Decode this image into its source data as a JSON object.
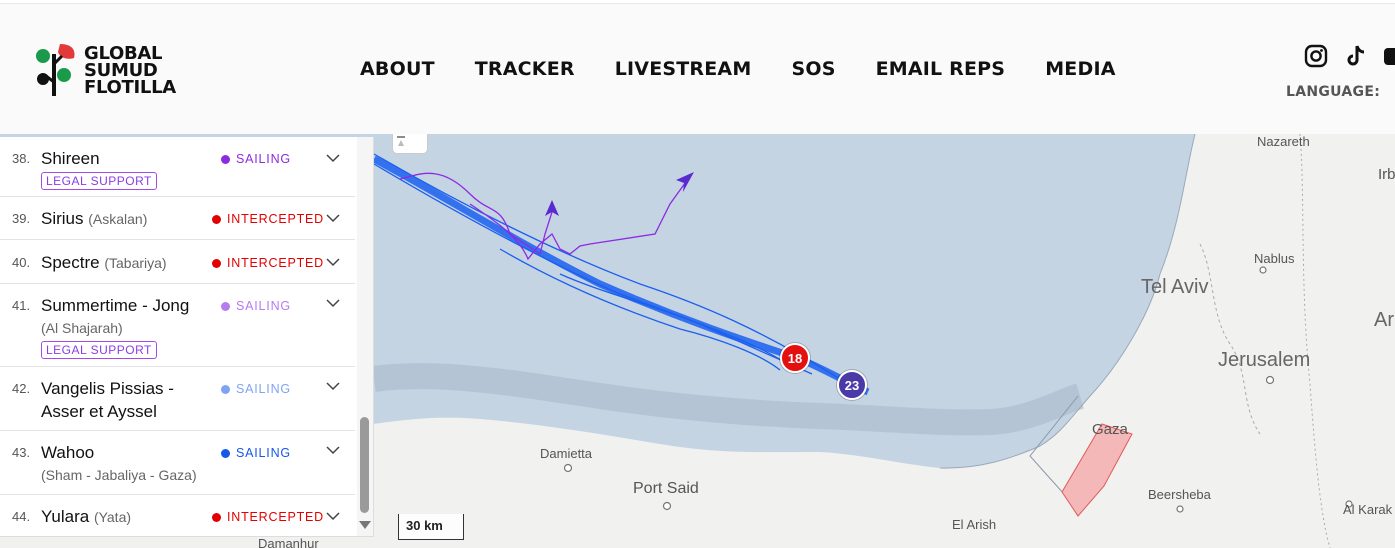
{
  "brand": {
    "logo_lines": [
      "GLOBAL",
      "SUMUD",
      "FLOTILLA"
    ]
  },
  "nav": {
    "items": [
      "ABOUT",
      "TRACKER",
      "LIVESTREAM",
      "SOS",
      "EMAIL REPS",
      "MEDIA"
    ]
  },
  "social": {
    "icons": [
      "instagram-icon",
      "tiktok-icon",
      "youtube-icon"
    ]
  },
  "language": {
    "label": "LANGUAGE:"
  },
  "colors": {
    "sailing_purple": "#8b2be2",
    "sailing_violet": "#b57bf0",
    "sailing_lightblue": "#7fa3f5",
    "sailing_blue": "#1557e6",
    "intercepted_red": "#e30000",
    "badge_purple": "#a24be8",
    "cluster_red": "#e41010",
    "cluster_indigo": "#4a3aa8",
    "track_blue": "#1a5ff0",
    "sea": "#c5d4e3",
    "land": "#f1f1f0",
    "gaza_fill": "#f5b8b8"
  },
  "vessels": [
    {
      "num": "38.",
      "name": "Shireen",
      "alt": "",
      "sub": "",
      "status": "SAILING",
      "status_color": "#8b2be2",
      "badge": "LEGAL SUPPORT"
    },
    {
      "num": "39.",
      "name": "Sirius",
      "alt": "(Askalan)",
      "sub": "",
      "status": "INTERCEPTED",
      "status_color": "#e30000",
      "badge": ""
    },
    {
      "num": "40.",
      "name": "Spectre",
      "alt": "(Tabariya)",
      "sub": "",
      "status": "INTERCEPTED",
      "status_color": "#e30000",
      "badge": ""
    },
    {
      "num": "41.",
      "name": "Summertime - Jong",
      "alt": "",
      "sub": "(Al Shajarah)",
      "status": "SAILING",
      "status_color": "#b57bf0",
      "badge": "LEGAL SUPPORT"
    },
    {
      "num": "42.",
      "name": "Vangelis Pissias -",
      "name2": "Asser et Ayssel",
      "alt": "",
      "sub": "",
      "status": "SAILING",
      "status_color": "#7fa3f5",
      "badge": ""
    },
    {
      "num": "43.",
      "name": "Wahoo",
      "alt": "",
      "sub": "(Sham - Jabaliya - Gaza)",
      "status": "SAILING",
      "status_color": "#1557e6",
      "badge": ""
    },
    {
      "num": "44.",
      "name": "Yulara",
      "alt": "(Yata)",
      "sub": "",
      "status": "INTERCEPTED",
      "status_color": "#e30000",
      "badge": ""
    }
  ],
  "map": {
    "places": [
      "Nazareth",
      "Irb",
      "Nablus",
      "Tel Aviv",
      "Ar",
      "Jerusalem",
      "Gaza",
      "Damietta",
      "Port Said",
      "Beersheba",
      "El Arish",
      "Al Karak",
      "Damanhur"
    ],
    "clusters": [
      {
        "label": "18",
        "color": "#e41010"
      },
      {
        "label": "23",
        "color": "#4a3aa8"
      }
    ],
    "scale_label": "30 km"
  }
}
